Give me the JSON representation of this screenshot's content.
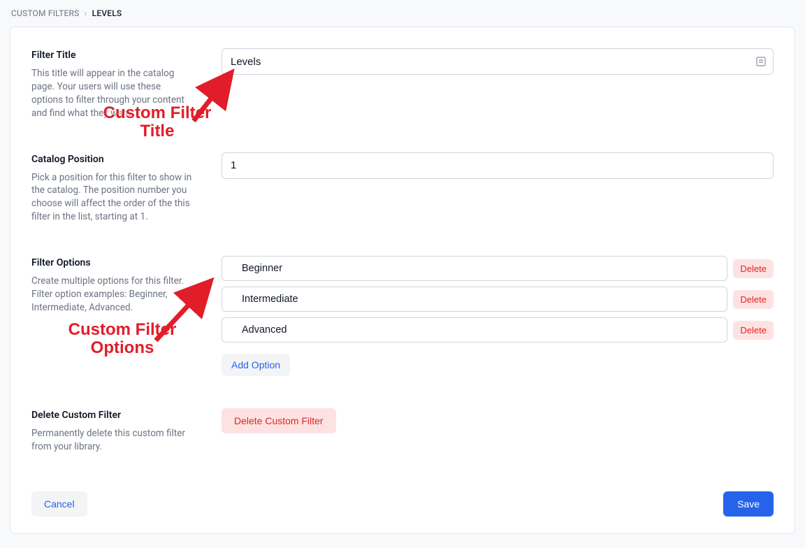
{
  "breadcrumb": {
    "parent": "CUSTOM FILTERS",
    "current": "LEVELS"
  },
  "sections": {
    "title": {
      "heading": "Filter Title",
      "description": "This title will appear in the catalog page. Your users will use these options to filter through your content and find what they want.",
      "value": "Levels"
    },
    "position": {
      "heading": "Catalog Position",
      "description": "Pick a position for this filter to show in the catalog. The position number you choose will affect the order of the this filter in the list, starting at 1.",
      "value": "1"
    },
    "options": {
      "heading": "Filter Options",
      "description": "Create multiple options for this filter. Filter option examples: Beginner, Intermediate, Advanced.",
      "items": [
        {
          "value": "Beginner",
          "delete_label": "Delete"
        },
        {
          "value": "Intermediate",
          "delete_label": "Delete"
        },
        {
          "value": "Advanced",
          "delete_label": "Delete"
        }
      ],
      "add_label": "Add Option"
    },
    "delete": {
      "heading": "Delete Custom Filter",
      "description": "Permanently delete this custom filter from your library.",
      "button_label": "Delete Custom Filter"
    }
  },
  "footer": {
    "cancel_label": "Cancel",
    "save_label": "Save"
  },
  "annotations": {
    "title_callout": "Custom Filter Title",
    "options_callout": "Custom Filter Options"
  },
  "colors": {
    "accent_blue": "#2563eb",
    "danger_red": "#dc2626",
    "danger_bg": "#fee2e2",
    "annotation_red": "#e11d2a"
  }
}
